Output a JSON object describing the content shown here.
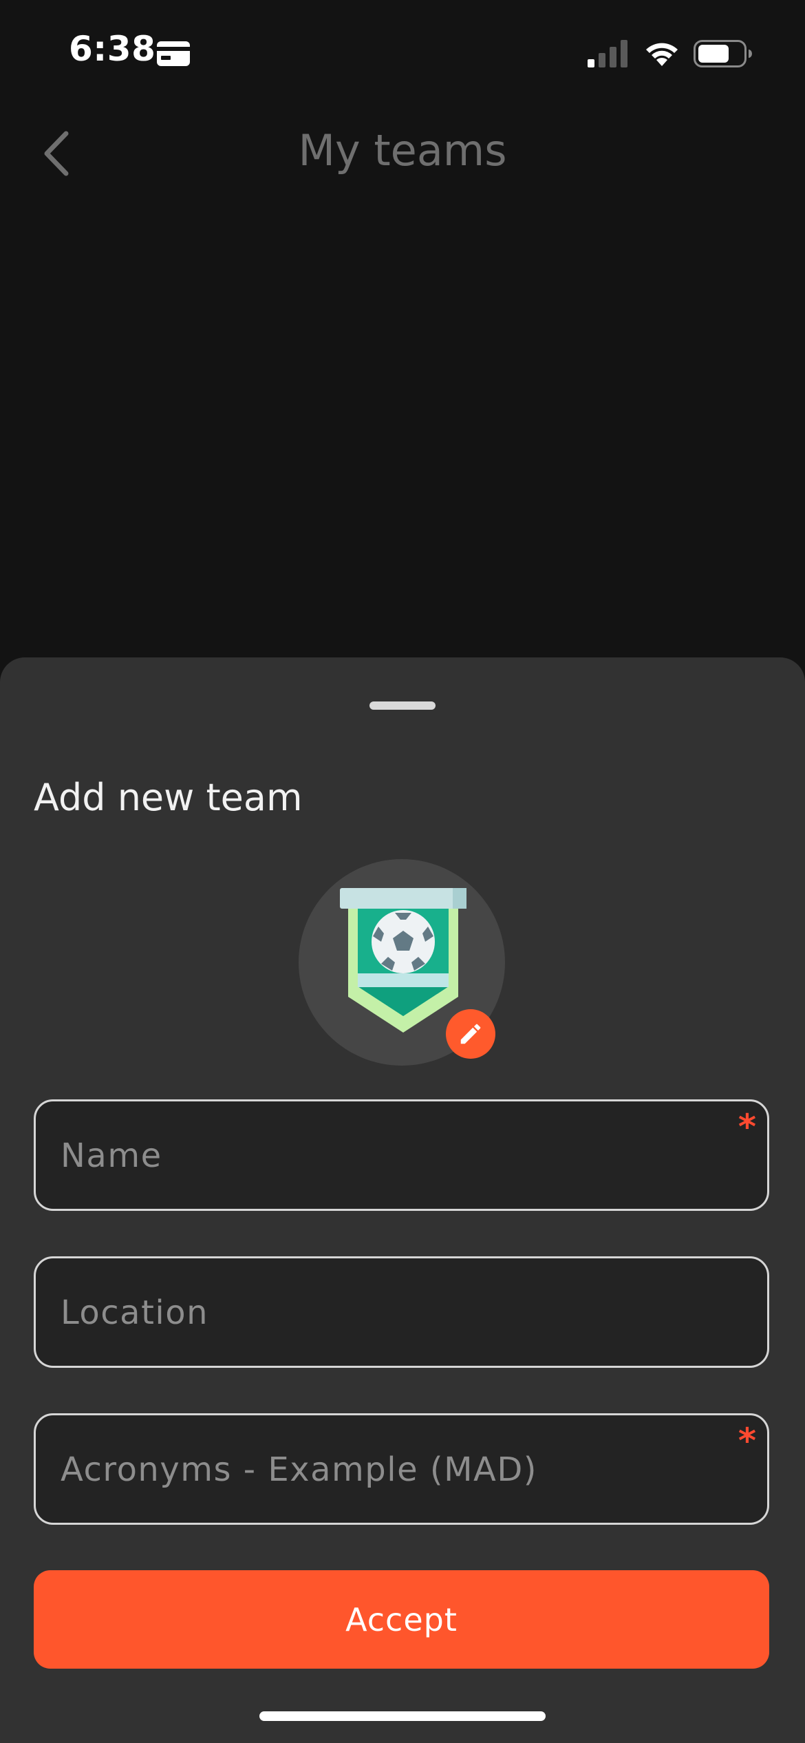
{
  "status_bar": {
    "time": "6:38",
    "icons": [
      "card-icon",
      "signal-icon",
      "wifi-icon",
      "battery-icon"
    ]
  },
  "nav": {
    "title": "My teams",
    "back_icon": "chevron-left-icon"
  },
  "sheet": {
    "title": "Add new team",
    "avatar_icon": "soccer-pennant-icon",
    "edit_icon": "pencil-icon",
    "fields": {
      "name": {
        "value": "",
        "placeholder": "Name",
        "required_mark": "*"
      },
      "location": {
        "value": "",
        "placeholder": "Location"
      },
      "acronym": {
        "value": "",
        "placeholder": "Acronyms - Example (MAD)",
        "required_mark": "*"
      }
    },
    "accept_label": "Accept"
  },
  "colors": {
    "background": "#131313",
    "sheet": "#323232",
    "accent": "#ff562c",
    "required": "#ff4a30",
    "field_border": "#d6d6d6",
    "field_bg": "#232323"
  }
}
